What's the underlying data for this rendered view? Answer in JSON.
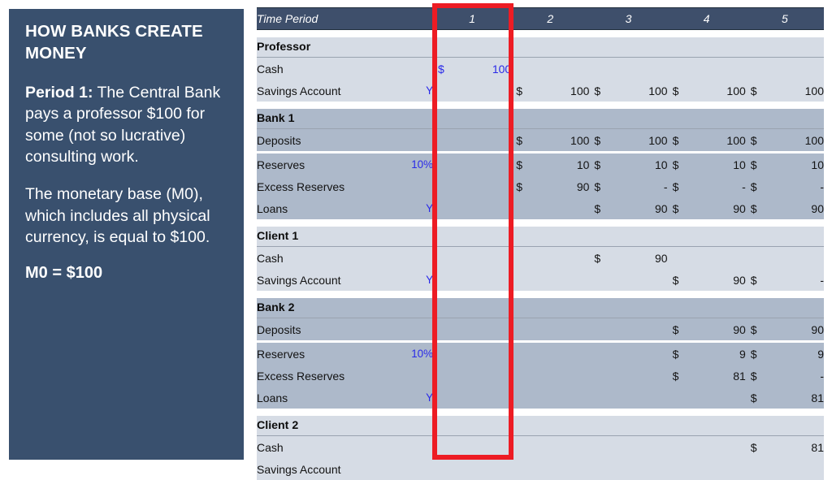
{
  "sidebar": {
    "title": "HOW BANKS CREATE MONEY",
    "paragraph1_lead": "Period 1:",
    "paragraph1_rest": " The Central Bank pays a professor $100 for some (not so lucrative) consulting work.",
    "paragraph2": "The monetary base (M0), which includes all physical currency, is equal to $100.",
    "paragraph3": "M0 = $100",
    "background_color": "#39506e",
    "text_color": "#ffffff"
  },
  "highlight": {
    "color": "#ed1c24",
    "target_column": "1"
  },
  "sheet": {
    "header": {
      "label": "Time Period",
      "periods": [
        "1",
        "2",
        "3",
        "4",
        "5"
      ]
    },
    "sections": [
      {
        "title": "Professor",
        "rows": [
          {
            "label": "Cash",
            "flag": "",
            "cells": [
              {
                "cur": "$",
                "val": "100",
                "blue": true
              },
              {
                "cur": "",
                "val": ""
              },
              {
                "cur": "",
                "val": ""
              },
              {
                "cur": "",
                "val": ""
              },
              {
                "cur": "",
                "val": ""
              }
            ]
          },
          {
            "label": "Savings Account",
            "flag": "Y",
            "cells": [
              {
                "cur": "",
                "val": ""
              },
              {
                "cur": "$",
                "val": "100"
              },
              {
                "cur": "$",
                "val": "100"
              },
              {
                "cur": "$",
                "val": "100"
              },
              {
                "cur": "$",
                "val": "100"
              }
            ]
          }
        ]
      },
      {
        "title": "Bank 1",
        "rows": [
          {
            "label": "Deposits",
            "flag": "",
            "cells": [
              {
                "cur": "",
                "val": ""
              },
              {
                "cur": "$",
                "val": "100"
              },
              {
                "cur": "$",
                "val": "100"
              },
              {
                "cur": "$",
                "val": "100"
              },
              {
                "cur": "$",
                "val": "100"
              }
            ]
          },
          {
            "label": "Reserves",
            "flag": "10%",
            "cells": [
              {
                "cur": "",
                "val": ""
              },
              {
                "cur": "$",
                "val": "10"
              },
              {
                "cur": "$",
                "val": "10"
              },
              {
                "cur": "$",
                "val": "10"
              },
              {
                "cur": "$",
                "val": "10"
              }
            ]
          },
          {
            "label": "Excess Reserves",
            "flag": "",
            "cells": [
              {
                "cur": "",
                "val": ""
              },
              {
                "cur": "$",
                "val": "90"
              },
              {
                "cur": "$",
                "val": "-"
              },
              {
                "cur": "$",
                "val": "-"
              },
              {
                "cur": "$",
                "val": "-"
              }
            ]
          },
          {
            "label": "Loans",
            "flag": "Y",
            "cells": [
              {
                "cur": "",
                "val": ""
              },
              {
                "cur": "",
                "val": ""
              },
              {
                "cur": "$",
                "val": "90"
              },
              {
                "cur": "$",
                "val": "90"
              },
              {
                "cur": "$",
                "val": "90"
              }
            ]
          }
        ]
      },
      {
        "title": "Client 1",
        "rows": [
          {
            "label": "Cash",
            "flag": "",
            "cells": [
              {
                "cur": "",
                "val": ""
              },
              {
                "cur": "",
                "val": ""
              },
              {
                "cur": "$",
                "val": "90"
              },
              {
                "cur": "",
                "val": ""
              },
              {
                "cur": "",
                "val": ""
              }
            ]
          },
          {
            "label": "Savings Account",
            "flag": "Y",
            "cells": [
              {
                "cur": "",
                "val": ""
              },
              {
                "cur": "",
                "val": ""
              },
              {
                "cur": "",
                "val": ""
              },
              {
                "cur": "$",
                "val": "90"
              },
              {
                "cur": "$",
                "val": "-"
              }
            ]
          }
        ]
      },
      {
        "title": "Bank 2",
        "rows": [
          {
            "label": "Deposits",
            "flag": "",
            "cells": [
              {
                "cur": "",
                "val": ""
              },
              {
                "cur": "",
                "val": ""
              },
              {
                "cur": "",
                "val": ""
              },
              {
                "cur": "$",
                "val": "90"
              },
              {
                "cur": "$",
                "val": "90"
              }
            ]
          },
          {
            "label": "Reserves",
            "flag": "10%",
            "cells": [
              {
                "cur": "",
                "val": ""
              },
              {
                "cur": "",
                "val": ""
              },
              {
                "cur": "",
                "val": ""
              },
              {
                "cur": "$",
                "val": "9"
              },
              {
                "cur": "$",
                "val": "9"
              }
            ]
          },
          {
            "label": "Excess Reserves",
            "flag": "",
            "cells": [
              {
                "cur": "",
                "val": ""
              },
              {
                "cur": "",
                "val": ""
              },
              {
                "cur": "",
                "val": ""
              },
              {
                "cur": "$",
                "val": "81"
              },
              {
                "cur": "$",
                "val": "-"
              }
            ]
          },
          {
            "label": "Loans",
            "flag": "Y",
            "cells": [
              {
                "cur": "",
                "val": ""
              },
              {
                "cur": "",
                "val": ""
              },
              {
                "cur": "",
                "val": ""
              },
              {
                "cur": "",
                "val": ""
              },
              {
                "cur": "$",
                "val": "81"
              }
            ]
          }
        ]
      },
      {
        "title": "Client 2",
        "rows": [
          {
            "label": "Cash",
            "flag": "",
            "cells": [
              {
                "cur": "",
                "val": ""
              },
              {
                "cur": "",
                "val": ""
              },
              {
                "cur": "",
                "val": ""
              },
              {
                "cur": "",
                "val": ""
              },
              {
                "cur": "$",
                "val": "81"
              }
            ]
          },
          {
            "label": "Savings Account",
            "flag": "",
            "cells": [
              {
                "cur": "",
                "val": ""
              },
              {
                "cur": "",
                "val": ""
              },
              {
                "cur": "",
                "val": ""
              },
              {
                "cur": "",
                "val": ""
              },
              {
                "cur": "",
                "val": ""
              }
            ]
          }
        ]
      }
    ]
  }
}
